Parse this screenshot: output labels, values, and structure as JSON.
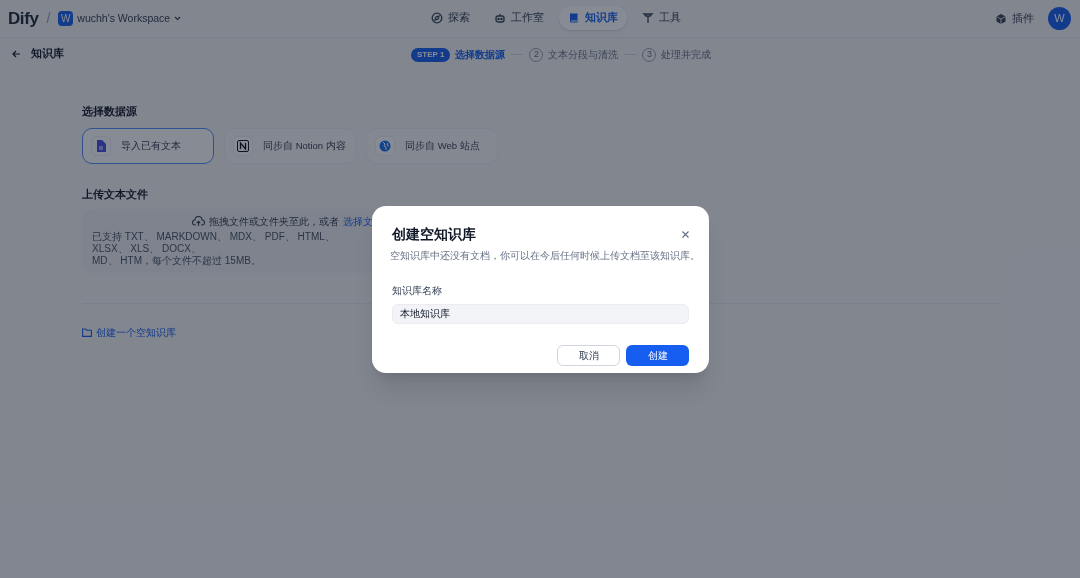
{
  "header": {
    "logo": "Dify",
    "separator": "/",
    "workspace": {
      "avatar": "W",
      "name": "wuchh's Workspace"
    },
    "nav": [
      {
        "label": "探索",
        "kind": "explore",
        "selected": false
      },
      {
        "label": "工作室",
        "kind": "studio",
        "selected": false
      },
      {
        "label": "知识库",
        "kind": "knowledge",
        "selected": true
      },
      {
        "label": "工具",
        "kind": "tools",
        "selected": false
      }
    ],
    "plugins": "插件",
    "user_avatar": "W"
  },
  "back": {
    "label": "知识库"
  },
  "steps": [
    {
      "number": "STEP 1",
      "label": "选择数据源",
      "selected": true
    },
    {
      "number": "2",
      "label": "文本分段与清洗",
      "selected": false
    },
    {
      "number": "3",
      "label": "处理并完成",
      "selected": false
    }
  ],
  "source_title": "选择数据源",
  "sources": [
    {
      "label": "导入已有文本",
      "kind": "file",
      "selected": true
    },
    {
      "label": "同步自 Notion 内容",
      "kind": "notion",
      "selected": false
    },
    {
      "label": "同步自 Web 站点",
      "kind": "web",
      "selected": false
    }
  ],
  "upload": {
    "title": "上传文本文件",
    "prompt": "拖拽文件或文件夹至此，或者",
    "link": "选择文",
    "formats_line_1": "已支持 TXT、 MARKDOWN、 MDX、 PDF、 HTML、 XLSX、 XLS、 DOCX、",
    "formats_line_2": "MD、 HTM，每个文件不超过 15MB。"
  },
  "create_empty_link": "创建一个空知识库",
  "dialog": {
    "title": "创建空知识库",
    "description": "空知识库中还没有文档，你可以在今后任何时候上传文档至该知识库。",
    "field_label": "知识库名称",
    "field_value": "本地知识库",
    "buttons": [
      {
        "label": "取消",
        "kind": "secondary"
      },
      {
        "label": "创建",
        "kind": "primary"
      }
    ]
  }
}
